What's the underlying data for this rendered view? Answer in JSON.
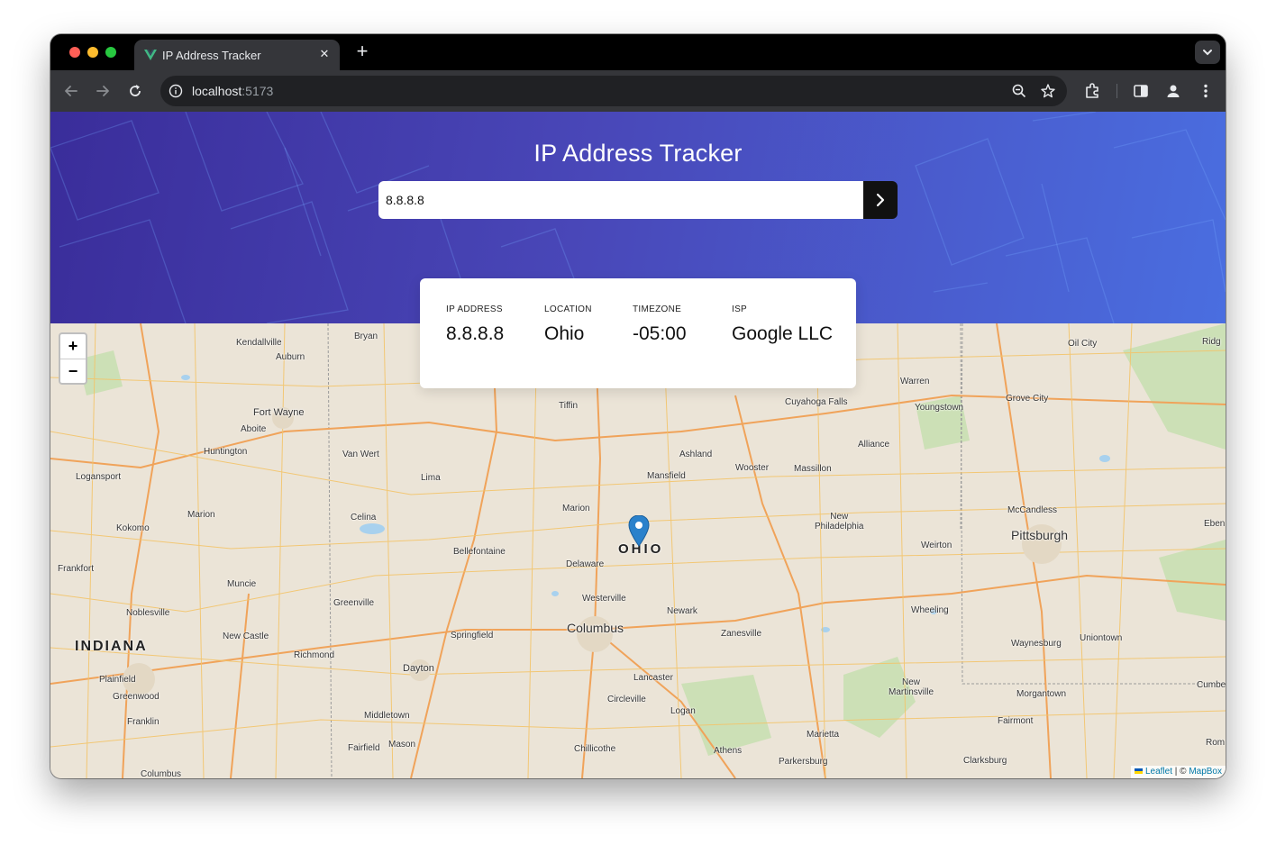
{
  "browser": {
    "tab_title": "IP Address Tracker",
    "url_host": "localhost",
    "url_port": ":5173"
  },
  "app": {
    "title": "IP Address Tracker",
    "search_value": "8.8.8.8"
  },
  "info": {
    "ip_label": "IP ADDRESS",
    "ip_value": "8.8.8.8",
    "location_label": "LOCATION",
    "location_value": "Ohio",
    "timezone_label": "TIMEZONE",
    "timezone_value": "-05:00",
    "isp_label": "ISP",
    "isp_value": "Google LLC"
  },
  "map": {
    "zoom_in": "+",
    "zoom_out": "−",
    "attribution_leaflet": "Leaflet",
    "attribution_sep": " | © ",
    "attribution_mapbox": "MapBox",
    "labels": {
      "kendallville": "Kendallville",
      "bryan": "Bryan",
      "auburn": "Auburn",
      "fort_wayne": "Fort Wayne",
      "aboite": "Aboite",
      "huntington": "Huntington",
      "van_wert": "Van Wert",
      "logansport": "Logansport",
      "lima": "Lima",
      "kokomo": "Kokomo",
      "marion_in": "Marion",
      "celina": "Celina",
      "frankfort": "Frankfort",
      "muncie": "Muncie",
      "noblesville": "Noblesville",
      "indiana": "INDIANA",
      "new_castle": "New Castle",
      "greenville": "Greenville",
      "richmond": "Richmond",
      "plainfield": "Plainfield",
      "greenwood": "Greenwood",
      "franklin": "Franklin",
      "columbus_in": "Columbus",
      "tiffin": "Tiffin",
      "ashland": "Ashland",
      "mansfield": "Mansfield",
      "marion_oh": "Marion",
      "bellefontaine": "Bellefontaine",
      "ohio": "OHIO",
      "delaware": "Delaware",
      "westerville": "Westerville",
      "columbus": "Columbus",
      "springfield": "Springfield",
      "dayton": "Dayton",
      "newark": "Newark",
      "zanesville": "Zanesville",
      "lancaster": "Lancaster",
      "circleville": "Circleville",
      "middletown": "Middletown",
      "fairfield": "Fairfield",
      "mason": "Mason",
      "chillicothe": "Chillicothe",
      "logan": "Logan",
      "athens": "Athens",
      "marietta": "Marietta",
      "parkersburg": "Parkersburg",
      "cuyahoga_falls": "Cuyahoga Falls",
      "warren": "Warren",
      "youngstown": "Youngstown",
      "alliance": "Alliance",
      "wooster": "Wooster",
      "massillon": "Massillon",
      "new_philadelphia": "New\nPhiladelphia",
      "weirton": "Weirton",
      "wheeling": "Wheeling",
      "oil_city": "Oil City",
      "grove_city": "Grove City",
      "mccandless": "McCandless",
      "pittsburgh": "Pittsburgh",
      "waynesburg": "Waynesburg",
      "uniontown": "Uniontown",
      "new_martinsville": "New\nMartinsville",
      "morgantown": "Morgantown",
      "fairmont": "Fairmont",
      "clarksburg": "Clarksburg",
      "ridg": "Ridg",
      "eben": "Eben",
      "cumbe": "Cumbe",
      "rom": "Rom"
    }
  },
  "colors": {
    "hero_start": "#3a2d9a",
    "hero_end": "#4a6ee0",
    "search_button": "#111111",
    "marker": "#2a81cb"
  },
  "icons": {
    "tab_favicon": "vue-logo-icon",
    "search_submit": "chevron-right-icon",
    "marker": "map-pin-icon"
  }
}
